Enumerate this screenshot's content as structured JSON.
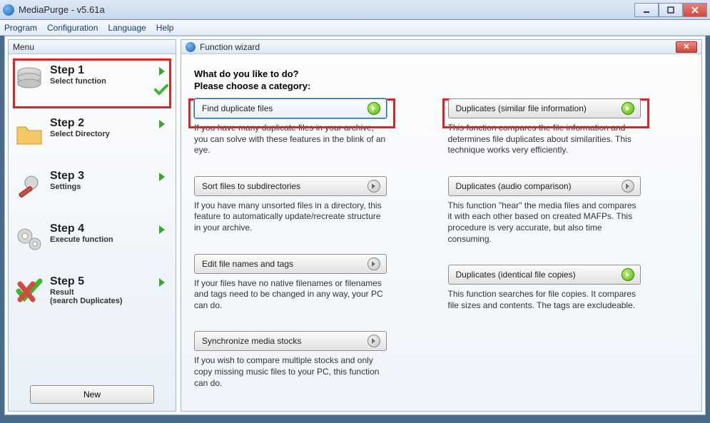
{
  "window": {
    "title": "MediaPurge - v5.61a"
  },
  "menubar": [
    "Program",
    "Configuration",
    "Language",
    "Help"
  ],
  "sidebar": {
    "header": "Menu",
    "steps": [
      {
        "title": "Step 1",
        "sub": "Select function"
      },
      {
        "title": "Step 2",
        "sub": "Select Directory"
      },
      {
        "title": "Step 3",
        "sub": "Settings"
      },
      {
        "title": "Step 4",
        "sub": "Execute function"
      },
      {
        "title": "Step 5",
        "sub": "Result\n(search Duplicates)"
      }
    ],
    "new_label": "New"
  },
  "wizard": {
    "header": "Function wizard",
    "prompt1": "What do you like to do?",
    "prompt2": "Please choose a category:",
    "left": [
      {
        "label": "Find duplicate files",
        "desc": "If you have many duplicate files in your archive, you can solve with these features in the blink of an eye.",
        "icon": "green",
        "selected": true
      },
      {
        "label": "Sort files to subdirectories",
        "desc": "If you have many unsorted files in a directory, this feature to automatically update/recreate structure in your archive.",
        "icon": "gray"
      },
      {
        "label": "Edit file names and tags",
        "desc": "If your files have no native filenames or filenames and tags need to be changed in any way, your PC can do.",
        "icon": "gray"
      },
      {
        "label": "Synchronize media stocks",
        "desc": "If you wish to compare multiple stocks and only copy missing music files to your PC, this function can do.",
        "icon": "gray"
      }
    ],
    "right": [
      {
        "label": "Duplicates (similar file information)",
        "desc": "This function compares the file information and determines file duplicates about similarities. This technique works very efficiently.",
        "icon": "green"
      },
      {
        "label": "Duplicates (audio comparison)",
        "desc": "This function \"hear\" the media files and compares it with each other based on created MAFPs. This procedure is very accurate, but also time consuming.",
        "icon": "gray"
      },
      {
        "label": "Duplicates (identical file copies)",
        "desc": "This function searches for file copies. It compares file sizes and contents. The tags are excludeable.",
        "icon": "green"
      }
    ]
  }
}
